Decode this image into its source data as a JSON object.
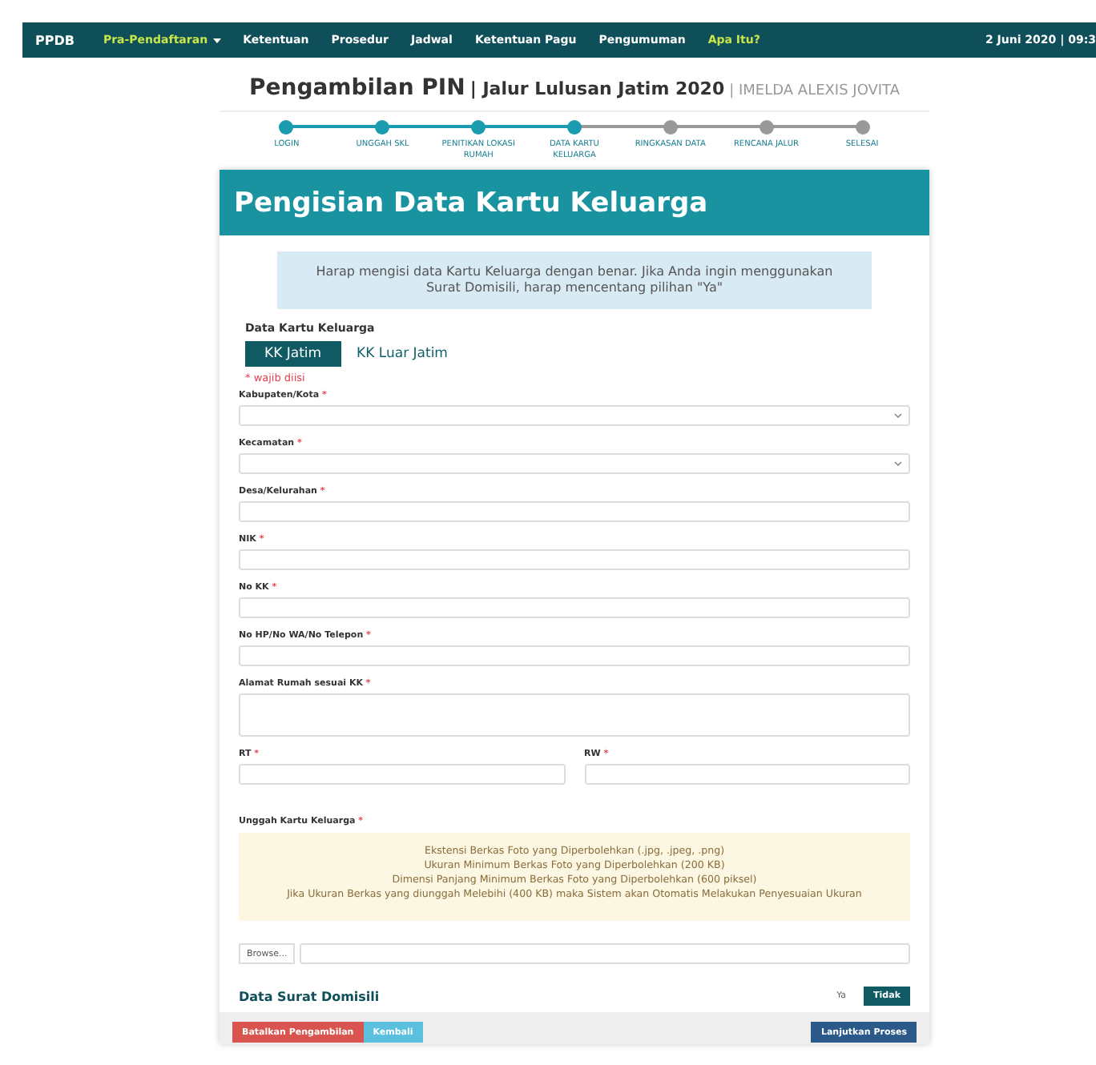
{
  "navbar": {
    "brand": "PPDB",
    "items": [
      {
        "label": "Pra-Pendaftaran",
        "dropdown": true,
        "highlight": true
      },
      {
        "label": "Ketentuan",
        "dropdown": false,
        "highlight": false
      },
      {
        "label": "Prosedur",
        "dropdown": false,
        "highlight": false
      },
      {
        "label": "Jadwal",
        "dropdown": false,
        "highlight": false
      },
      {
        "label": "Ketentuan Pagu",
        "dropdown": false,
        "highlight": false
      },
      {
        "label": "Pengumuman",
        "dropdown": false,
        "highlight": false
      },
      {
        "label": "Apa Itu?",
        "dropdown": false,
        "highlight": true
      }
    ],
    "datetime": "2 Juni 2020 | 09:3"
  },
  "page_title": {
    "main": "Pengambilan PIN",
    "track": "| Jalur Lulusan Jatim 2020",
    "user": "| IMELDA ALEXIS JOVITA"
  },
  "steps": [
    {
      "label": "LOGIN",
      "done": true
    },
    {
      "label": "UNGGAH SKL",
      "done": true
    },
    {
      "label": "PENITIKAN LOKASI RUMAH",
      "done": true
    },
    {
      "label": "DATA KARTU KELUARGA",
      "done": true
    },
    {
      "label": "RINGKASAN DATA",
      "done": false
    },
    {
      "label": "RENCANA JALUR",
      "done": false
    },
    {
      "label": "SELESAI",
      "done": false
    }
  ],
  "card": {
    "title": "Pengisian Data Kartu Keluarga",
    "info": "Harap mengisi data Kartu Keluarga dengan benar. Jika Anda ingin menggunakan Surat Domisili, harap mencentang pilihan \"Ya\"",
    "section": "Data Kartu Keluarga",
    "kk_tabs": [
      {
        "label": "KK Jatim",
        "selected": true
      },
      {
        "label": "KK Luar Jatim",
        "selected": false
      }
    ],
    "required_note": "* wajib diisi",
    "required_mark": "*",
    "fields": [
      {
        "label": "Kabupaten/Kota",
        "kind": "select"
      },
      {
        "label": "Kecamatan",
        "kind": "select"
      },
      {
        "label": "Desa/Kelurahan",
        "kind": "text"
      },
      {
        "label": "NIK",
        "kind": "text"
      },
      {
        "label": "No KK",
        "kind": "text"
      },
      {
        "label": "No HP/No WA/No Telepon",
        "kind": "text"
      },
      {
        "label": "Alamat Rumah sesuai KK",
        "kind": "textarea"
      },
      {
        "label": "RT",
        "kind": "half"
      },
      {
        "label": "RW",
        "kind": "half"
      }
    ],
    "upload": {
      "label": "Unggah Kartu Keluarga",
      "notes": [
        "Ekstensi Berkas Foto yang Diperbolehkan (.jpg, .jpeg, .png)",
        "Ukuran Minimum Berkas Foto yang Diperbolehkan (200 KB)",
        "Dimensi Panjang Minimum Berkas Foto yang Diperbolehkan (600 piksel)",
        "Jika Ukuran Berkas yang diunggah Melebihi (400 KB) maka Sistem akan Otomatis Melakukan Penyesuaian Ukuran"
      ],
      "browse": "Browse..."
    },
    "domisili": {
      "title": "Data Surat Domisili",
      "options": [
        {
          "label": "Ya",
          "selected": false
        },
        {
          "label": "Tidak",
          "selected": true
        }
      ]
    },
    "buttons": [
      {
        "label": "Batalkan Pengambilan",
        "kind": "danger"
      },
      {
        "label": "Kembali",
        "kind": "info"
      },
      {
        "label": "Lanjutkan Proses",
        "kind": "primary"
      }
    ]
  }
}
